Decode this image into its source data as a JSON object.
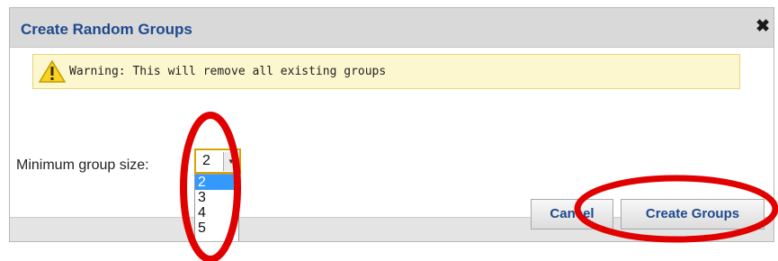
{
  "dialog": {
    "title": "Create Random Groups",
    "close_glyph": "✖",
    "warning_text": "Warning: This will remove all existing groups",
    "min_group_label": "Minimum group size:",
    "select": {
      "value": "2",
      "arrow": "▼",
      "options": [
        "2",
        "3",
        "4",
        "5"
      ],
      "highlighted_option": "2"
    },
    "cancel_label": "Cancel",
    "create_label": "Create Groups"
  },
  "colors": {
    "title": "#1e4a8e",
    "warning_bg": "#fdf7cf",
    "annotation": "#e00000",
    "option_highlight": "#3399ff"
  },
  "icons": {
    "warning": "warning-triangle-icon",
    "close": "close-icon"
  }
}
